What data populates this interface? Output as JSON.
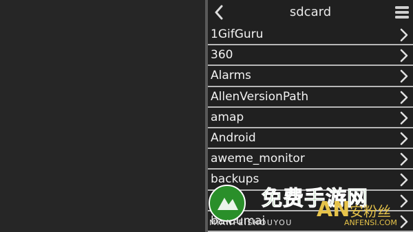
{
  "header": {
    "title": "sdcard",
    "back_icon": "chevron-left-icon",
    "menu_icon": "hamburger-menu-icon"
  },
  "folders": [
    {
      "label": "1GifGuru"
    },
    {
      "label": "360"
    },
    {
      "label": "Alarms"
    },
    {
      "label": "AllenVersionPath"
    },
    {
      "label": "amap"
    },
    {
      "label": "Android"
    },
    {
      "label": "aweme_monitor"
    },
    {
      "label": "backups"
    },
    {
      "label": "baidu"
    },
    {
      "label": "baidumai"
    }
  ],
  "watermark": {
    "chinese_text": "免费手游网",
    "english_text": "MIANFEISHOUYOU",
    "secondary_logo": "AN",
    "secondary_text": "安粉丝",
    "secondary_en": "ANFENSI.COM"
  },
  "colors": {
    "background": "#262626",
    "panel": "#202020",
    "divider": "#b8b8b8",
    "text": "#f2f2f2",
    "watermark_green": "#2a8f2a",
    "watermark_gold": "#e6c34a"
  }
}
